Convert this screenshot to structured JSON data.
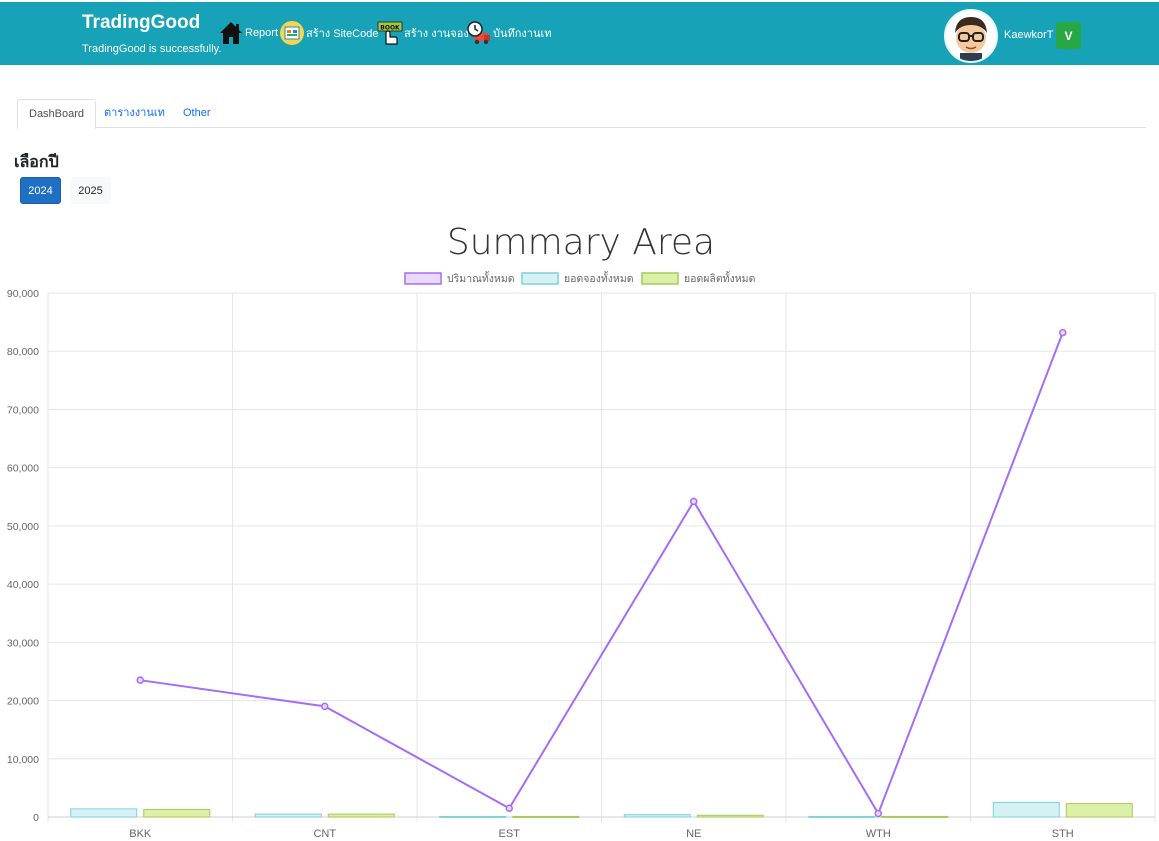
{
  "header": {
    "brand_title": "TradingGood",
    "brand_subtitle": "TradingGood is successfully.",
    "nav": [
      {
        "label": "Report",
        "icon": "home-icon"
      },
      {
        "label": "สร้าง SiteCode",
        "icon": "sitecode-icon"
      },
      {
        "label": "สร้าง งานจอง",
        "icon": "book-hand-icon"
      },
      {
        "label": "บันทึกงานเท",
        "icon": "truck-clock-icon"
      }
    ],
    "user_name": "KaewkorT",
    "user_badge": "V",
    "colors": {
      "bar": "#17a2b8",
      "badge": "#28a745"
    }
  },
  "tabs": [
    {
      "label": "DashBoard",
      "active": true
    },
    {
      "label": "ตารางงานเท",
      "active": false
    },
    {
      "label": "Other",
      "active": false
    }
  ],
  "year_selector": {
    "label": "เลือกปี",
    "options": [
      "2024",
      "2025"
    ],
    "selected": "2024"
  },
  "chart_data": {
    "type": "bar",
    "title": "Summary Area",
    "categories": [
      "BKK",
      "CNT",
      "EST",
      "NE",
      "WTH",
      "STH"
    ],
    "ylim": [
      0,
      90000
    ],
    "yticks": [
      0,
      10000,
      20000,
      30000,
      40000,
      50000,
      60000,
      70000,
      80000,
      90000
    ],
    "grid": true,
    "legend_position": "top",
    "series": [
      {
        "name": "ปริมาณทั้งหมด",
        "type": "line",
        "values": [
          23500,
          19000,
          1500,
          54200,
          600,
          83200
        ],
        "color": "#a66cf5",
        "fill": "#ead9ff"
      },
      {
        "name": "ยอดจองทั้งหมด",
        "type": "bar",
        "values": [
          1400,
          500,
          100,
          400,
          100,
          2500
        ],
        "color": "#7fd1d8",
        "fill": "#d6f1f3"
      },
      {
        "name": "ยอดผลิตทั้งหมด",
        "type": "bar",
        "values": [
          1300,
          500,
          100,
          300,
          100,
          2300
        ],
        "color": "#a6c95a",
        "fill": "#dcf0a8"
      }
    ]
  }
}
